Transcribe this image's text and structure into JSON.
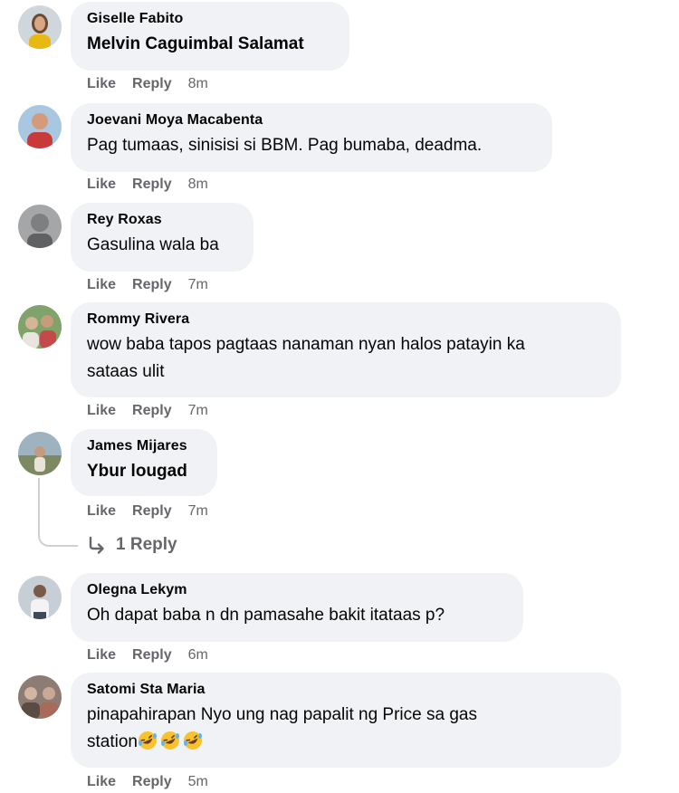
{
  "comments": [
    {
      "name": "Giselle Fabito",
      "text": "Melvin Caguimbal Salamat",
      "like": "Like",
      "reply": "Reply",
      "time": "8m",
      "avatar": "avatar-photo-woman-yellow"
    },
    {
      "name": "Joevani Moya Macabenta",
      "text": "Pag tumaas, sinisisi si BBM. Pag bumaba, deadma.",
      "like": "Like",
      "reply": "Reply",
      "time": "8m",
      "avatar": "avatar-photo-person-red"
    },
    {
      "name": "Rey Roxas",
      "text": "Gasulina wala ba",
      "like": "Like",
      "reply": "Reply",
      "time": "7m",
      "avatar": "avatar-photo-grey"
    },
    {
      "name": "Rommy Rivera",
      "text_line1": "wow baba tapos pagtaas nanaman nyan halos patayin ka",
      "text_line2": "sataas ulit",
      "like": "Like",
      "reply": "Reply",
      "time": "7m",
      "avatar": "avatar-photo-group"
    },
    {
      "name": "James Mijares",
      "text": "Ybur lougad",
      "like": "Like",
      "reply": "Reply",
      "time": "7m",
      "avatar": "avatar-photo-outdoor"
    },
    {
      "name": "Olegna Lekym",
      "text": "Oh dapat baba n dn pamasahe bakit itataas p?",
      "like": "Like",
      "reply": "Reply",
      "time": "6m",
      "avatar": "avatar-photo-man"
    },
    {
      "name": "Satomi Sta Maria",
      "text_line1": "pinapahirapan Nyo ung nag papalit ng Price sa gas",
      "text_line2": "station",
      "like": "Like",
      "reply": "Reply",
      "time": "5m",
      "avatar": "avatar-photo-group-2",
      "emoji": "rolling-laughing-emoji"
    }
  ],
  "replies_link": {
    "label": "1 Reply",
    "icon": "reply-arrow-icon"
  },
  "colors": {
    "bubble": "#f0f2f5",
    "meta": "#65676b",
    "text": "#050505"
  }
}
